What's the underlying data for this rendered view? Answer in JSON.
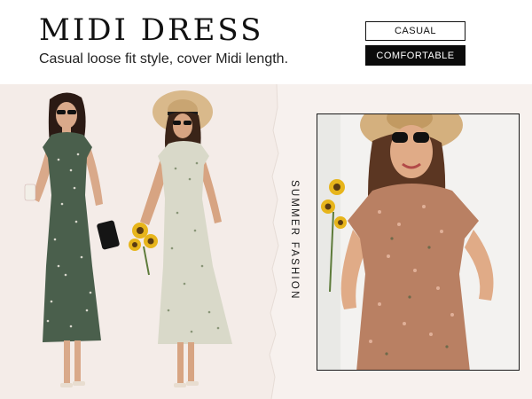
{
  "header": {
    "title": "MIDI DRESS",
    "subtitle": "Casual loose fit style, cover Midi length."
  },
  "tags": {
    "casual": "CASUAL",
    "comfortable": "COMFORTABLE"
  },
  "side_label": "SUMMER FASHION",
  "images": {
    "left": [
      "woman-green-floral-dress",
      "woman-white-floral-dress-straw-hat"
    ],
    "right": "woman-floral-dress-straw-hat-closeup"
  },
  "colors": {
    "background": "#f4ece8",
    "accent": "#0b0b0b",
    "dress_green": "#4a5f4c",
    "dress_cream": "#d9d9c9",
    "dress_floral": "#b98063"
  }
}
